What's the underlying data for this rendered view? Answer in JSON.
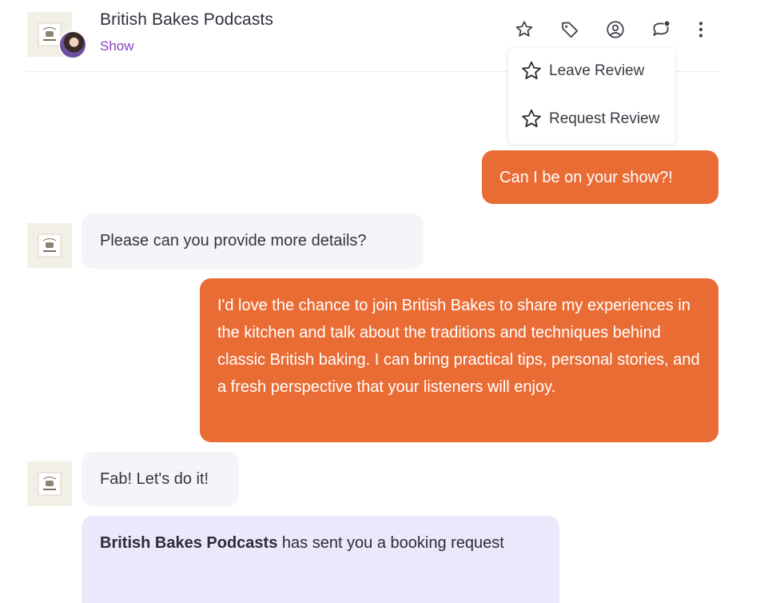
{
  "header": {
    "title": "British Bakes Podcasts",
    "subtitle": "Show",
    "logo_icon": "podcast-logo-icon",
    "avatar_icon": "user-avatar",
    "actions": [
      {
        "name": "star-icon"
      },
      {
        "name": "tag-icon"
      },
      {
        "name": "user-circle-icon"
      },
      {
        "name": "chat-notification-icon"
      },
      {
        "name": "more-vertical-icon"
      }
    ]
  },
  "dropdown": {
    "items": [
      {
        "label": "Leave Review",
        "icon": "star-icon"
      },
      {
        "label": "Request Review",
        "icon": "star-icon"
      }
    ]
  },
  "messages": [
    {
      "sender": "me",
      "text": "Can I be on your show?!"
    },
    {
      "sender": "British Bakes Podcasts",
      "text": "Please can you provide more details?"
    },
    {
      "sender": "me",
      "text": "I'd love the chance to join British Bakes to share my experiences in the kitchen and talk about the traditions and techniques behind classic British baking. I can bring practical tips, personal stories, and a fresh perspective that your listeners will enjoy."
    },
    {
      "sender": "British Bakes Podcasts",
      "text": "Fab! Let's do it!"
    }
  ],
  "booking": {
    "sender_bold": "British Bakes Podcasts",
    "text_rest": "has sent you a booking request"
  },
  "colors": {
    "accent_orange": "#ea6c35",
    "link_purple": "#8a3fc2",
    "incoming_bubble": "#f4f5f9",
    "booking_bubble": "#ece7fb"
  }
}
